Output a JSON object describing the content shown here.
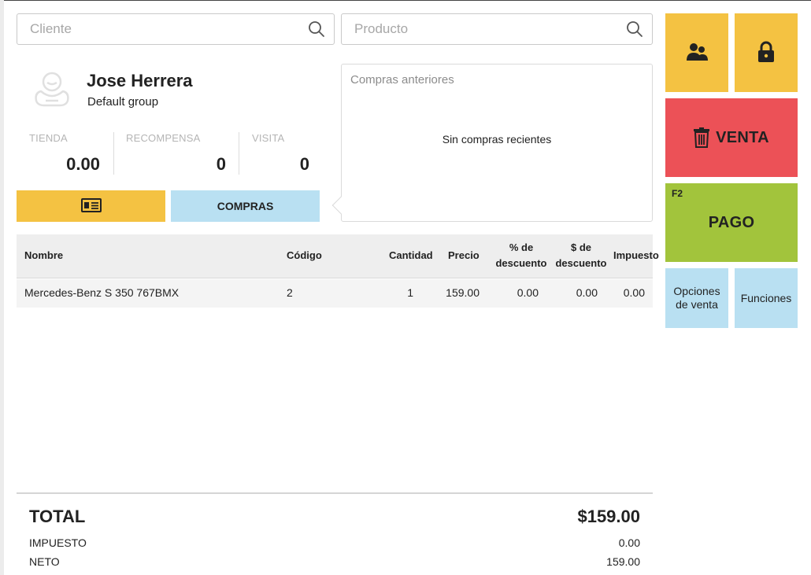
{
  "search": {
    "customer_placeholder": "Cliente",
    "product_placeholder": "Producto"
  },
  "customer": {
    "name": "Jose Herrera",
    "group": "Default group",
    "stats": [
      {
        "label": "TIENDA",
        "value": "0.00"
      },
      {
        "label": "RECOMPENSA",
        "value": "0"
      },
      {
        "label": "VISITA",
        "value": "0"
      }
    ],
    "purchases_button": "COMPRAS"
  },
  "previous_purchases": {
    "title": "Compras anteriores",
    "empty_text": "Sin compras recientes"
  },
  "table": {
    "headers": {
      "name": "Nombre",
      "code": "Código",
      "qty": "Cantidad",
      "price": "Precio",
      "pct_discount_1": "% de",
      "pct_discount_2": "descuento",
      "amt_discount_1": "$ de",
      "amt_discount_2": "descuento",
      "tax": "Impuesto"
    },
    "rows": [
      {
        "name": "Mercedes-Benz S 350 767BMX",
        "code": "2",
        "qty": "1",
        "price": "159.00",
        "pct_discount": "0.00",
        "amt_discount": "0.00",
        "tax": "0.00"
      }
    ]
  },
  "actions": {
    "sale_label": "VENTA",
    "pay_shortcut": "F2",
    "pay_label": "PAGO",
    "sale_options_1": "Opciones",
    "sale_options_2": "de venta",
    "functions_label": "Funciones"
  },
  "totals": {
    "total_label": "TOTAL",
    "total_value": "$159.00",
    "tax_label": "IMPUESTO",
    "tax_value": "0.00",
    "net_label": "NETO",
    "net_value": "159.00"
  },
  "colors": {
    "yellow": "#f4c242",
    "red": "#ec5157",
    "green": "#a2c43c",
    "light_blue": "#b9e0f2"
  },
  "icons": {
    "search": "search-icon",
    "avatar": "baby-avatar-icon",
    "card": "id-card-icon",
    "customers": "users-icon",
    "lock": "lock-icon",
    "trash": "trash-icon"
  }
}
